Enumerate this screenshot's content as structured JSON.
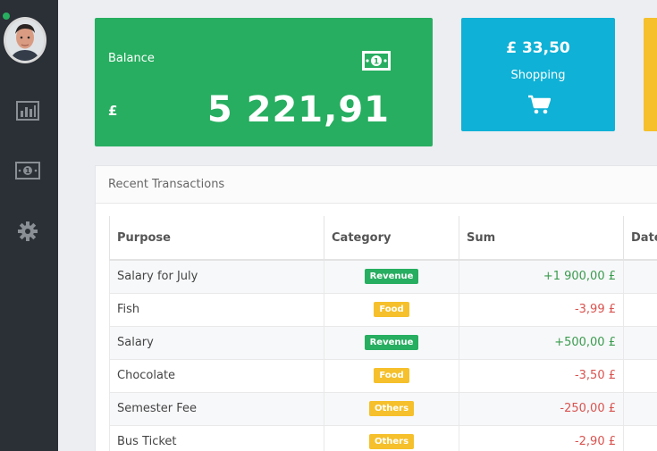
{
  "sidebar": {
    "status_color": "#27ae60",
    "items": [
      {
        "icon": "bar-chart-icon"
      },
      {
        "icon": "money-icon"
      },
      {
        "icon": "gear-icon"
      }
    ]
  },
  "balance_card": {
    "label": "Balance",
    "currency": "£",
    "amount": "5 221,91",
    "icon": "money-icon",
    "color": "#27ae60"
  },
  "shopping_card": {
    "amount": "£ 33,50",
    "label": "Shopping",
    "icon": "shopping-cart-icon",
    "color": "#0fb1d6"
  },
  "third_card": {
    "color": "#f5c02b"
  },
  "transactions": {
    "title": "Recent Transactions",
    "columns": [
      "Purpose",
      "Category",
      "Sum",
      "Date"
    ],
    "rows": [
      {
        "purpose": "Salary for July",
        "category": "Revenue",
        "sum": "+1 900,00 £"
      },
      {
        "purpose": "Fish",
        "category": "Food",
        "sum": "-3,99 £"
      },
      {
        "purpose": "Salary",
        "category": "Revenue",
        "sum": "+500,00 £"
      },
      {
        "purpose": "Chocolate",
        "category": "Food",
        "sum": "-3,50 £"
      },
      {
        "purpose": "Semester Fee",
        "category": "Others",
        "sum": "-250,00 £"
      },
      {
        "purpose": "Bus Ticket",
        "category": "Others",
        "sum": "-2,90 £"
      }
    ],
    "category_colors": {
      "Revenue": "#27ae60",
      "Food": "#f5c02b",
      "Others": "#f5c02b"
    }
  }
}
